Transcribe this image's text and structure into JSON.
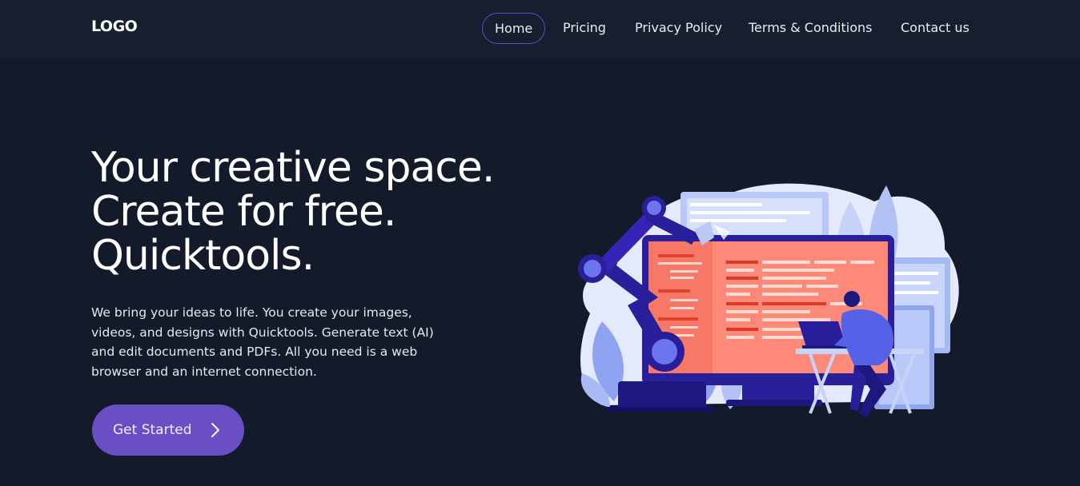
{
  "header": {
    "logo": "LOGO",
    "nav": [
      {
        "label": "Home",
        "active": true
      },
      {
        "label": "Pricing",
        "active": false
      },
      {
        "label": "Privacy Policy",
        "active": false
      },
      {
        "label": "Terms & Conditions",
        "active": false
      },
      {
        "label": "Contact us",
        "active": false
      }
    ]
  },
  "hero": {
    "title": "Your creative space. Create for free. Quicktools.",
    "description": "We bring your ideas to life. You create your images, videos, and designs with Quicktools. Generate text (AI) and edit documents and PDFs. All you need is a web browser and an internet connection.",
    "cta_label": "Get Started"
  },
  "colors": {
    "background": "#131a2a",
    "header": "#171e2e",
    "accent": "#6a4fc4",
    "active_border": "#5a4fd0"
  },
  "icons": {
    "cta": "chevron-right-icon",
    "illustration": "robot-arm-computer-illustration"
  }
}
